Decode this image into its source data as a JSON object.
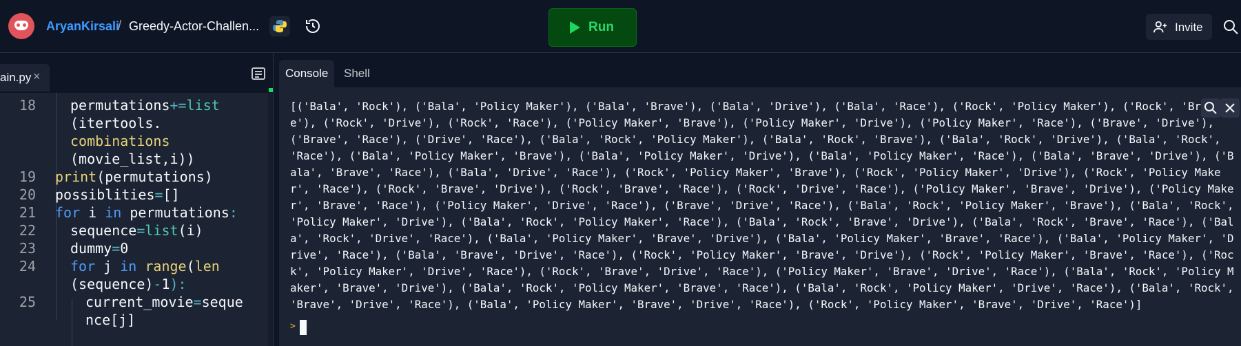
{
  "header": {
    "username": "AryanKirsali",
    "separator": "/",
    "repl_name": "Greedy-Actor-Challen...",
    "run_label": "Run",
    "invite_label": "Invite",
    "icons": [
      "replit-avatar-icon",
      "python-icon",
      "history-icon",
      "play-icon",
      "add-user-icon",
      "search-icon"
    ]
  },
  "editor": {
    "tab_label": "ain.py",
    "tab_close": "×",
    "lines": [
      {
        "num": "18",
        "segments": [
          {
            "t": "permutations",
            "c": "#f5f9fc"
          },
          {
            "t": "+=",
            "c": "#56b6c2"
          },
          {
            "t": "list",
            "c": "#4ec9b0"
          }
        ]
      },
      {
        "num": "",
        "segments": [
          {
            "t": "(itertools.",
            "c": "#f5f9fc"
          }
        ]
      },
      {
        "num": "",
        "segments": [
          {
            "t": "combinations",
            "c": "#e5d17a"
          }
        ]
      },
      {
        "num": "",
        "segments": [
          {
            "t": "(movie_list,i))",
            "c": "#f5f9fc"
          }
        ]
      },
      {
        "num": "19",
        "segments": [
          {
            "t": "print",
            "c": "#e5d17a"
          },
          {
            "t": "(permutations)",
            "c": "#f5f9fc"
          }
        ]
      },
      {
        "num": "20",
        "segments": [
          {
            "t": "possiblities",
            "c": "#f5f9fc"
          },
          {
            "t": "=",
            "c": "#56b6c2"
          },
          {
            "t": "[]",
            "c": "#f5f9fc"
          }
        ]
      },
      {
        "num": "21",
        "segments": [
          {
            "t": "for",
            "c": "#4f9cf9"
          },
          {
            "t": " i ",
            "c": "#f5f9fc"
          },
          {
            "t": "in",
            "c": "#4f9cf9"
          },
          {
            "t": " permutations",
            "c": "#f5f9fc"
          },
          {
            "t": ":",
            "c": "#56b6c2"
          }
        ]
      },
      {
        "num": "22",
        "segments": [
          {
            "t": "sequence",
            "c": "#f5f9fc"
          },
          {
            "t": "=",
            "c": "#56b6c2"
          },
          {
            "t": "list",
            "c": "#4ec9b0"
          },
          {
            "t": "(i)",
            "c": "#f5f9fc"
          }
        ]
      },
      {
        "num": "23",
        "segments": [
          {
            "t": "dummy",
            "c": "#f5f9fc"
          },
          {
            "t": "=",
            "c": "#56b6c2"
          },
          {
            "t": "0",
            "c": "#f5f9fc"
          }
        ]
      },
      {
        "num": "24",
        "segments": [
          {
            "t": "for",
            "c": "#4f9cf9"
          },
          {
            "t": " j ",
            "c": "#f5f9fc"
          },
          {
            "t": "in",
            "c": "#4f9cf9"
          },
          {
            "t": " ",
            "c": "#f5f9fc"
          },
          {
            "t": "range",
            "c": "#e5d17a"
          },
          {
            "t": "(",
            "c": "#f5f9fc"
          },
          {
            "t": "len",
            "c": "#e5d17a"
          }
        ]
      },
      {
        "num": "",
        "segments": [
          {
            "t": "(sequence)",
            "c": "#f5f9fc"
          },
          {
            "t": "-",
            "c": "#56b6c2"
          },
          {
            "t": "1",
            "c": "#f5f9fc"
          },
          {
            "t": "):",
            "c": "#56b6c2"
          }
        ]
      },
      {
        "num": "25",
        "segments": [
          {
            "t": "current_movie",
            "c": "#f5f9fc"
          },
          {
            "t": "=",
            "c": "#56b6c2"
          },
          {
            "t": "seque",
            "c": "#f5f9fc"
          }
        ]
      },
      {
        "num": "",
        "segments": [
          {
            "t": "nce[j]",
            "c": "#f5f9fc"
          }
        ]
      }
    ]
  },
  "console": {
    "tabs": [
      "Console",
      "Shell"
    ],
    "output": "[('Bala', 'Rock'), ('Bala', 'Policy Maker'), ('Bala', 'Brave'), ('Bala', 'Drive'), ('Bala', 'Race'), ('Rock', 'Policy Maker'), ('Rock', 'Brave'), ('Rock', 'Drive'), ('Rock', 'Race'), ('Policy Maker', 'Brave'), ('Policy Maker', 'Drive'), ('Policy Maker', 'Race'), ('Brave', 'Drive'), ('Brave', 'Race'), ('Drive', 'Race'), ('Bala', 'Rock', 'Policy Maker'), ('Bala', 'Rock', 'Brave'), ('Bala', 'Rock', 'Drive'), ('Bala', 'Rock', 'Race'), ('Bala', 'Policy Maker', 'Brave'), ('Bala', 'Policy Maker', 'Drive'), ('Bala', 'Policy Maker', 'Race'), ('Bala', 'Brave', 'Drive'), ('Bala', 'Brave', 'Race'), ('Bala', 'Drive', 'Race'), ('Rock', 'Policy Maker', 'Brave'), ('Rock', 'Policy Maker', 'Drive'), ('Rock', 'Policy Maker', 'Race'), ('Rock', 'Brave', 'Drive'), ('Rock', 'Brave', 'Race'), ('Rock', 'Drive', 'Race'), ('Policy Maker', 'Brave', 'Drive'), ('Policy Maker', 'Brave', 'Race'), ('Policy Maker', 'Drive', 'Race'), ('Brave', 'Drive', 'Race'), ('Bala', 'Rock', 'Policy Maker', 'Brave'), ('Bala', 'Rock', 'Policy Maker', 'Drive'), ('Bala', 'Rock', 'Policy Maker', 'Race'), ('Bala', 'Rock', 'Brave', 'Drive'), ('Bala', 'Rock', 'Brave', 'Race'), ('Bala', 'Rock', 'Drive', 'Race'), ('Bala', 'Policy Maker', 'Brave', 'Drive'), ('Bala', 'Policy Maker', 'Brave', 'Race'), ('Bala', 'Policy Maker', 'Drive', 'Race'), ('Bala', 'Brave', 'Drive', 'Race'), ('Rock', 'Policy Maker', 'Brave', 'Drive'), ('Rock', 'Policy Maker', 'Brave', 'Race'), ('Rock', 'Policy Maker', 'Drive', 'Race'), ('Rock', 'Brave', 'Drive', 'Race'), ('Policy Maker', 'Brave', 'Drive', 'Race'), ('Bala', 'Rock', 'Policy Maker', 'Brave', 'Drive'), ('Bala', 'Rock', 'Policy Maker', 'Brave', 'Race'), ('Bala', 'Rock', 'Policy Maker', 'Drive', 'Race'), ('Bala', 'Rock', 'Brave', 'Drive', 'Race'), ('Bala', 'Policy Maker', 'Brave', 'Drive', 'Race'), ('Rock', 'Policy Maker', 'Brave', 'Drive', 'Race')]",
    "prompt": ">"
  },
  "colors": {
    "accent_blue": "#3e9bff",
    "run_green": "#2fd46a",
    "background": "#0e1525",
    "panel": "#1c2333"
  }
}
